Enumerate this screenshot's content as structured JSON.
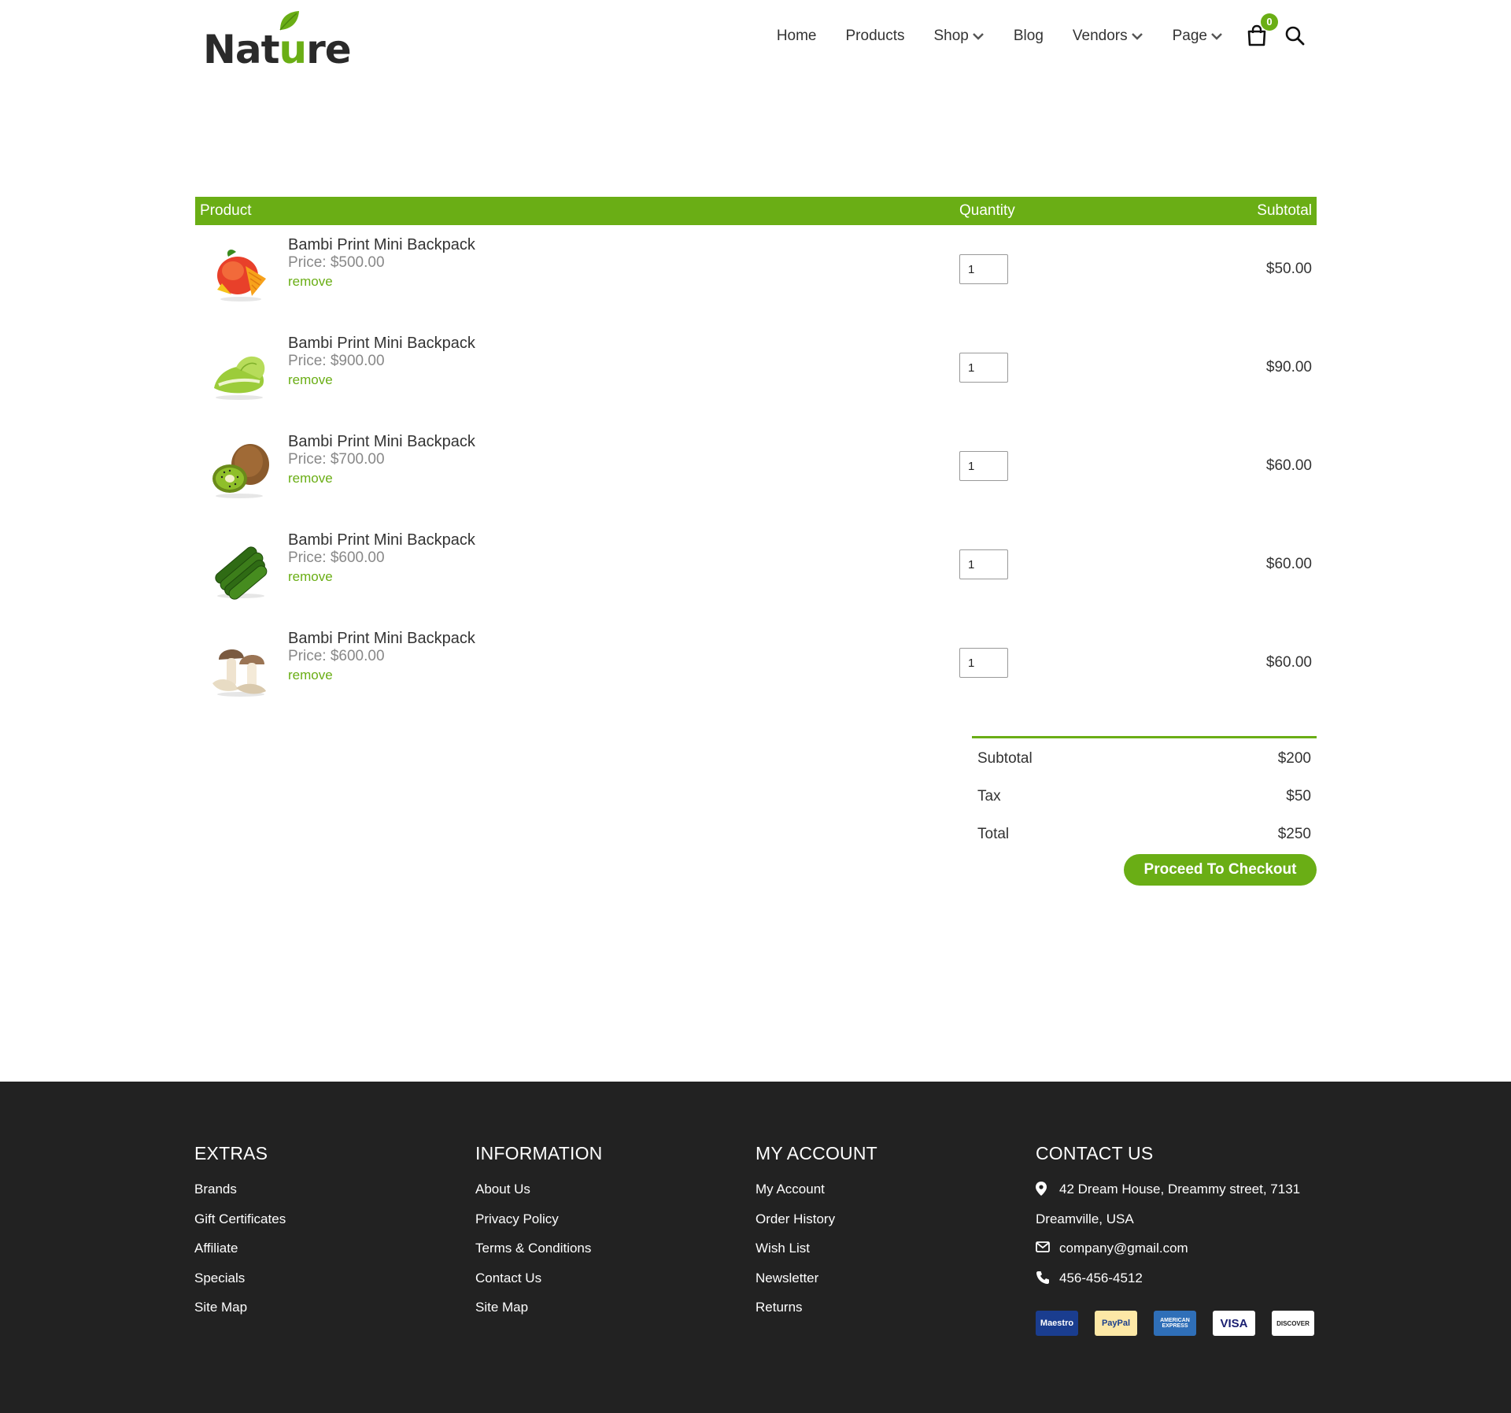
{
  "header": {
    "logo": {
      "text_before": "Nat",
      "text_accent": "u",
      "text_after": "re"
    },
    "nav": [
      {
        "label": "Home",
        "dropdown": false
      },
      {
        "label": "Products",
        "dropdown": false
      },
      {
        "label": "Shop",
        "dropdown": true
      },
      {
        "label": "Blog",
        "dropdown": false
      },
      {
        "label": "Vendors",
        "dropdown": true
      },
      {
        "label": "Page",
        "dropdown": true
      }
    ],
    "cart_count": "0",
    "icons": {
      "cart": "shopping-bag-icon",
      "search": "search-icon"
    }
  },
  "cart": {
    "headers": {
      "product": "Product",
      "quantity": "Quantity",
      "subtotal": "Subtotal"
    },
    "items": [
      {
        "name": "Bambi Print Mini Backpack",
        "price": "Price: $500.00",
        "remove": "remove",
        "quantity": "1",
        "subtotal": "$50.00",
        "image": "mango"
      },
      {
        "name": "Bambi Print Mini Backpack",
        "price": "Price: $900.00",
        "remove": "remove",
        "quantity": "1",
        "subtotal": "$90.00",
        "image": "lettuce"
      },
      {
        "name": "Bambi Print Mini Backpack",
        "price": "Price: $700.00",
        "remove": "remove",
        "quantity": "1",
        "subtotal": "$60.00",
        "image": "kiwi"
      },
      {
        "name": "Bambi Print Mini Backpack",
        "price": "Price: $600.00",
        "remove": "remove",
        "quantity": "1",
        "subtotal": "$60.00",
        "image": "cucumber"
      },
      {
        "name": "Bambi Print Mini Backpack",
        "price": "Price: $600.00",
        "remove": "remove",
        "quantity": "1",
        "subtotal": "$60.00",
        "image": "mushroom"
      }
    ]
  },
  "totals": {
    "subtotal_label": "Subtotal",
    "subtotal_value": "$200",
    "tax_label": "Tax",
    "tax_value": "$50",
    "total_label": "Total",
    "total_value": "$250",
    "checkout_label": "Proceed To Checkout"
  },
  "footer": {
    "extras": {
      "title": "EXTRAS",
      "links": [
        "Brands",
        "Gift Certificates",
        "Affiliate",
        "Specials",
        "Site Map"
      ]
    },
    "information": {
      "title": "INFORMATION",
      "links": [
        "About Us",
        "Privacy Policy",
        "Terms & Conditions",
        "Contact Us",
        "Site Map"
      ]
    },
    "account": {
      "title": "MY ACCOUNT",
      "links": [
        "My Account",
        "Order History",
        "Wish List",
        "Newsletter",
        "Returns"
      ]
    },
    "contact": {
      "title": "CONTACT US",
      "address_line1": "42 Dream House, Dreammy street, 7131",
      "address_line2": "Dreamville, USA",
      "email": "company@gmail.com",
      "phone": "456-456-4512",
      "payments": [
        {
          "label": "Maestro",
          "bg": "#1a3d8f",
          "fg": "#ffffff"
        },
        {
          "label": "PayPal",
          "bg": "#fde8a6",
          "fg": "#1b3e8c"
        },
        {
          "label": "AMERICAN EXPRESS",
          "bg": "#2f6fb8",
          "fg": "#ffffff"
        },
        {
          "label": "VISA",
          "bg": "#ffffff",
          "fg": "#1a1f71"
        },
        {
          "label": "DISCOVER",
          "bg": "#ffffff",
          "fg": "#222222"
        }
      ]
    }
  },
  "colors": {
    "accent": "#6aae15",
    "footer_bg": "#222222"
  }
}
